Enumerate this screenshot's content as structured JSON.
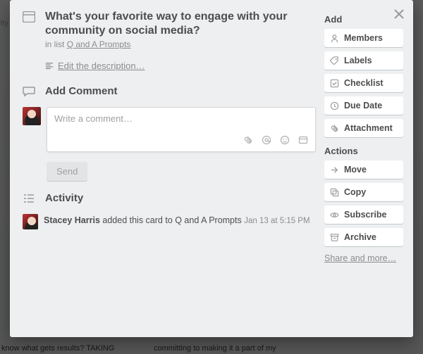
{
  "card": {
    "title": "What's your favorite way to engage with your community on social media?",
    "in_list_prefix": "in list ",
    "list_name": "Q and A Prompts"
  },
  "edit_description": "Edit the description…",
  "comment_section": {
    "heading": "Add Comment",
    "placeholder": "Write a comment…",
    "send_label": "Send"
  },
  "activity_section": {
    "heading": "Activity",
    "entries": [
      {
        "user": "Stacey Harris",
        "action": " added this card to Q and A Prompts ",
        "time": "Jan 13 at 5:15 PM"
      }
    ]
  },
  "sidebar": {
    "add_heading": "Add",
    "add_items": {
      "members": "Members",
      "labels": "Labels",
      "checklist": "Checklist",
      "due_date": "Due Date",
      "attachment": "Attachment"
    },
    "actions_heading": "Actions",
    "action_items": {
      "move": "Move",
      "copy": "Copy",
      "subscribe": "Subscribe",
      "archive": "Archive"
    },
    "share_more": "Share and more…"
  },
  "bg_snip1": "ility",
  "bg_snip2": "know what gets results? TAKING",
  "bg_snip3": "committing to making it a part of my"
}
